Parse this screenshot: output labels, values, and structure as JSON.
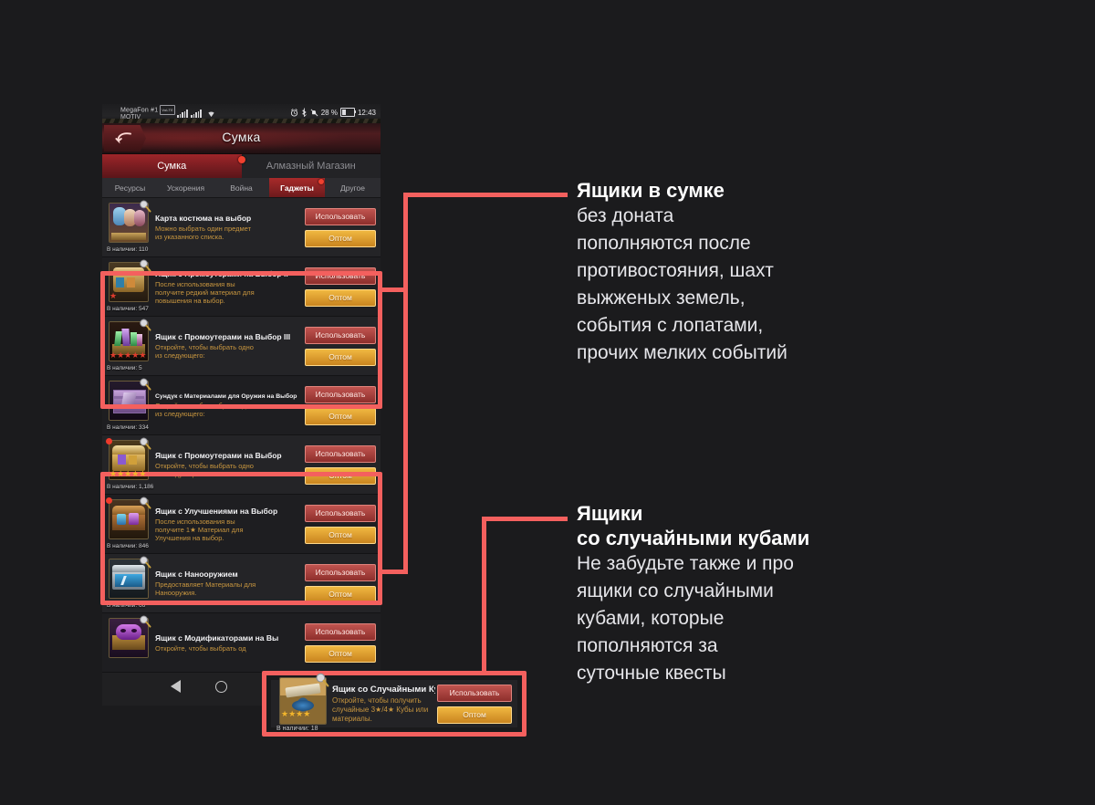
{
  "statusbar": {
    "carrier_line1": "MegaFon #1",
    "carrier_badge": "VoLTE",
    "carrier_line2": "MOTIV",
    "battery_percent": "28 %",
    "clock": "12:43",
    "icons": [
      "alarm-icon",
      "bluetooth-icon",
      "mute-icon",
      "battery-icon"
    ]
  },
  "header": {
    "back_icon": "back-arrow-icon",
    "title": "Сумка"
  },
  "main_tabs": [
    {
      "label": "Сумка",
      "active": true,
      "badge": true
    },
    {
      "label": "Алмазный Магазин",
      "active": false,
      "badge": false
    }
  ],
  "sub_tabs": [
    {
      "label": "Ресурсы",
      "active": false,
      "badge": false
    },
    {
      "label": "Ускорения",
      "active": false,
      "badge": false
    },
    {
      "label": "Война",
      "active": false,
      "badge": false
    },
    {
      "label": "Гаджеты",
      "active": true,
      "badge": true
    },
    {
      "label": "Другое",
      "active": false,
      "badge": false
    }
  ],
  "buttons": {
    "use": "Использовать",
    "bulk": "Оптом"
  },
  "items": [
    {
      "name": "Карта костюма на выбор",
      "desc": "Можно выбрать один предмет\nиз указанного списка.",
      "qty_label": "В наличии: 110",
      "stars": 0,
      "star_color": "#e03b2d",
      "new_badge": false,
      "name_small": false
    },
    {
      "name": "Ящик с Промоутерами на Выбор II",
      "desc": "После использования вы\nполучите редкий материал для\nповышения на выбор.",
      "qty_label": "В наличии: 547",
      "stars": 1,
      "star_color": "#e03b2d",
      "new_badge": false,
      "name_small": false
    },
    {
      "name": "Ящик с Промоутерами на Выбор III",
      "desc": "Откройте, чтобы выбрать одно\nиз следующего:",
      "qty_label": "В наличии: 5",
      "stars": 5,
      "star_color": "#e03b2d",
      "new_badge": false,
      "name_small": false
    },
    {
      "name": "Сундук с Материалами для Оружия на Выбор",
      "desc": "Откройте, чтобы выбрать одно\nиз следующего:",
      "qty_label": "В наличии: 334",
      "stars": 0,
      "star_color": "#e03b2d",
      "new_badge": false,
      "name_small": true
    },
    {
      "name": "Ящик с Промоутерами на Выбор",
      "desc": "Откройте, чтобы выбрать одно\nиз следующего:",
      "qty_label": "В наличии: 1,186",
      "stars": 5,
      "star_color": "#f2b52c",
      "new_badge": true,
      "name_small": false
    },
    {
      "name": "Ящик с Улучшениями на Выбор",
      "desc": "После использования вы\nполучите 1★ Материал для\nУлучшения на выбор.",
      "qty_label": "В наличии: 846",
      "stars": 0,
      "star_color": "#f2b52c",
      "new_badge": true,
      "name_small": false
    },
    {
      "name": "Ящик с Нанооружием",
      "desc": "Предоставляет Материалы для\nНанооружия.",
      "qty_label": "В наличии: 66",
      "stars": 0,
      "star_color": "#f2b52c",
      "new_badge": false,
      "name_small": false
    },
    {
      "name": "Ящик с Модификаторами на Вы",
      "desc": "Откройте, чтобы выбрать од",
      "qty_label": "",
      "stars": 0,
      "star_color": "#f2b52c",
      "new_badge": false,
      "name_small": false
    }
  ],
  "callout_item": {
    "name": "Ящик со Случайными Кубами",
    "desc": "Откройте, чтобы получить\nслучайные 3★/4★ Кубы или\nматериалы.",
    "qty_label": "В наличии: 18",
    "stars": 4,
    "star_color": "#f2b52c"
  },
  "annotations": [
    {
      "title": "Ящики в сумке",
      "body": "без доната\nпополняются после\nпротивостояния, шахт\nвыжженых земель,\nсобытия с лопатами,\nпрочих мелких событий"
    },
    {
      "title": "Ящики\nсо случайными кубами",
      "body": "Не забудьте также и про\nящики со случайными\nкубами, которые\nпополняются за\nсуточные квесты"
    }
  ],
  "nav_overlay": {
    "back_icon": "nav-back-triangle-icon",
    "home_icon": "nav-home-circle-icon"
  },
  "colors": {
    "accent_red": "#f4605e",
    "page_bg": "#1b1b1d",
    "gold": "#f0b841",
    "use_red": "#c0544f"
  }
}
